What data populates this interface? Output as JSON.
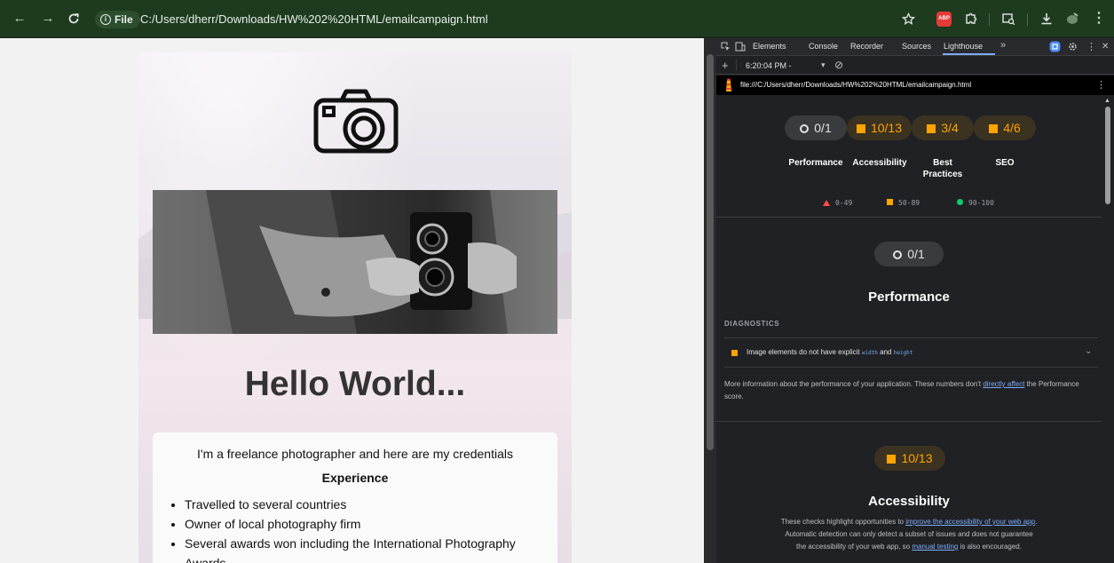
{
  "browser": {
    "back_icon": "arrow-left-icon",
    "forward_icon": "arrow-right-icon",
    "reload_icon": "reload-icon",
    "site_chip_label": "File",
    "url": "C:/Users/dherr/Downloads/HW%202%20HTML/emailcampaign.html",
    "abp_label": "ABP",
    "accent": "#1e3b20"
  },
  "email": {
    "headline": "Hello World...",
    "intro": "I'm a freelance photographer and here are my credentials",
    "experience_heading": "Experience",
    "experience_items": [
      "Travelled to several countries",
      "Owner of local photography firm",
      "Several awards won including the International Photography Awards"
    ]
  },
  "devtools": {
    "tabs": [
      "Elements",
      "Console",
      "Recorder",
      "Sources",
      "Lighthouse"
    ],
    "active_tab": "Lighthouse",
    "more_tabs": "»",
    "add_label": "+",
    "report_time": "6:20:04 PM -",
    "report_dropdown_arrow": "▾",
    "clear_icon": "⊘",
    "report_url": "file:///C:/Users/dherr/Downloads/HW%202%20HTML/emailcampaign.html",
    "more_icon": "⋮",
    "close_icon": "✕"
  },
  "lighthouse": {
    "scores": [
      {
        "label": "Performance",
        "value": "0/1",
        "status": "neutral"
      },
      {
        "label": "Accessibility",
        "value": "10/13",
        "status": "average"
      },
      {
        "label_line1": "Best",
        "label_line2": "Practices",
        "value": "3/4",
        "status": "average"
      },
      {
        "label": "SEO",
        "value": "4/6",
        "status": "average"
      }
    ],
    "legend": {
      "fail": "0-49",
      "average": "50-89",
      "pass": "90-100"
    },
    "performance": {
      "score": "0/1",
      "title": "Performance",
      "diagnostics_heading": "DIAGNOSTICS",
      "audit_prefix": "Image elements do not have explicit ",
      "audit_code1": "width",
      "audit_mid": " and ",
      "audit_code2": "height",
      "info_part1": "More information about the performance of your application. These numbers don't ",
      "info_link": "directly affect",
      "info_part2": " the Performance score."
    },
    "accessibility": {
      "score": "10/13",
      "title": "Accessibility",
      "desc_part1": "These checks highlight opportunities to ",
      "desc_link1": "improve the accessibility of your web app",
      "desc_part2": ". Automatic detection can only detect a subset of issues and does not guarantee the accessibility of your web app, so ",
      "desc_link2": "manual testing",
      "desc_part3": " is also encouraged."
    },
    "colors": {
      "average": "#ffa400",
      "fail": "#ff4e42",
      "pass": "#0cce6b"
    }
  }
}
